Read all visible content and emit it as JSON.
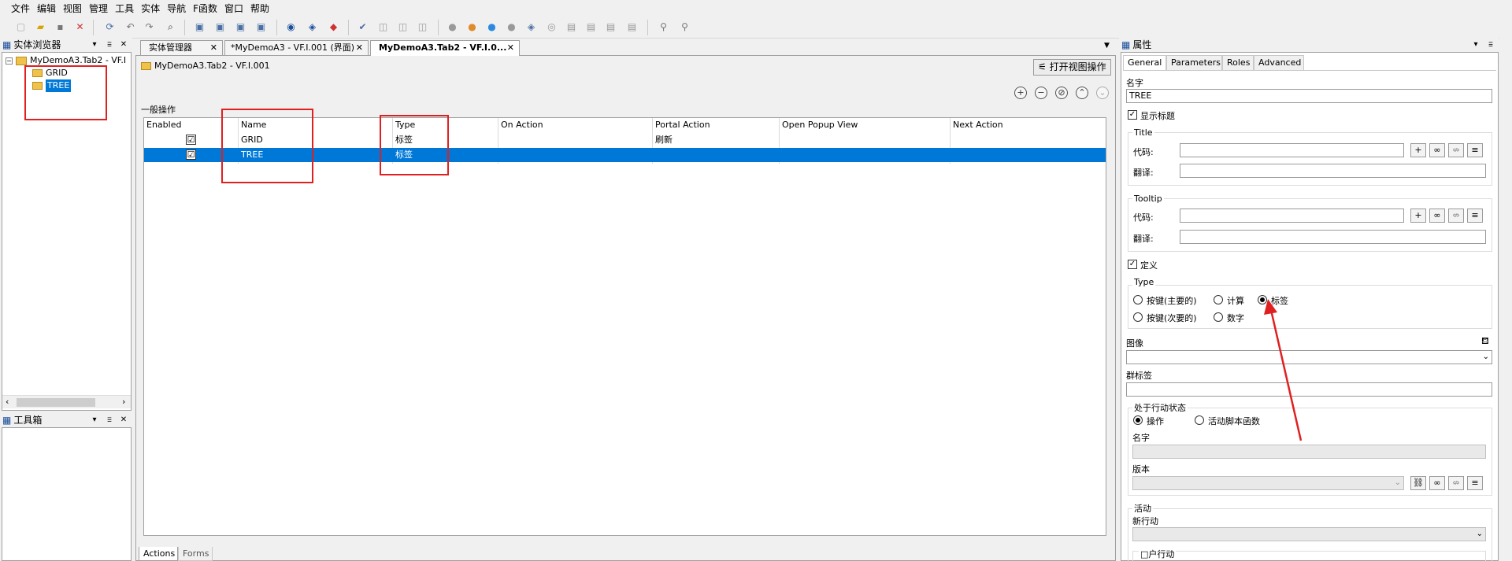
{
  "menu": [
    "文件",
    "编辑",
    "视图",
    "管理",
    "工具",
    "实体",
    "导航",
    "F函数",
    "窗口",
    "帮助"
  ],
  "entity_browser": {
    "title": "实体浏览器",
    "root": "MyDemoA3.Tab2 - VF.I",
    "children": [
      "GRID",
      "TREE"
    ],
    "selected": "TREE"
  },
  "toolbox": {
    "title": "工具箱"
  },
  "tabs": [
    {
      "label": "实体管理器"
    },
    {
      "label": "*MyDemoA3 - VF.I.001 (界面)"
    },
    {
      "label": "MyDemoA3.Tab2 - VF.I.0..."
    }
  ],
  "editor": {
    "breadcrumb": "MyDemoA3.Tab2 - VF.I.001",
    "open_view_button": "打开视图操作",
    "section_title": "一般操作",
    "columns": [
      "Enabled",
      "Name",
      "Type",
      "On Action",
      "Portal Action",
      "Open Popup View",
      "Next Action"
    ],
    "rows": [
      {
        "enabled": "☑",
        "name": "GRID",
        "type": "标签",
        "on_action": "",
        "portal_action": "刷新",
        "open_popup_view": "",
        "next_action": ""
      },
      {
        "enabled": "☑",
        "name": "TREE",
        "type": "标签",
        "on_action": "",
        "portal_action": "",
        "open_popup_view": "",
        "next_action": ""
      }
    ],
    "bottom_tabs": [
      "Actions",
      "Forms"
    ]
  },
  "properties": {
    "title": "属性",
    "tabs": [
      "General",
      "Parameters",
      "Roles",
      "Advanced"
    ],
    "name_label": "名字",
    "name_value": "TREE",
    "show_title_label": "显示标题",
    "title_group": "Title",
    "code_label": "代码:",
    "translate_label": "翻译:",
    "tooltip_group": "Tooltip",
    "define_label": "定义",
    "type_group": "Type",
    "type_options": [
      "按键(主要的)",
      "计算",
      "标签",
      "按键(次要的)",
      "数字"
    ],
    "type_selected": "标签",
    "image_label": "图像",
    "group_label": "群标签",
    "state_group": "处于行动状态",
    "state_options": [
      "操作",
      "活动脚本函数"
    ],
    "state_name_label": "名字",
    "version_label": "版本",
    "activity_group": "活动",
    "new_action_label": "新行动",
    "user_action_label": "□户行动"
  },
  "colors": {
    "selection": "#0078d7",
    "annotation": "#e02020"
  }
}
